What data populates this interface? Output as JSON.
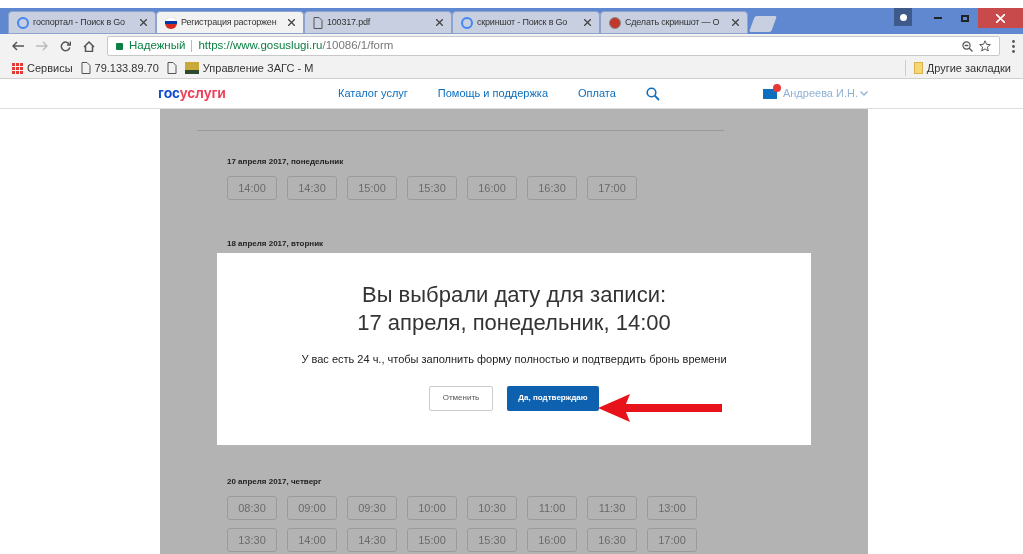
{
  "browser": {
    "tabs": [
      {
        "label": "госпортал - Поиск в Go",
        "kind": "google",
        "selected": false
      },
      {
        "label": "Регистрация расторжен",
        "kind": "flag",
        "selected": true
      },
      {
        "label": "100317.pdf",
        "kind": "page",
        "selected": false
      },
      {
        "label": "скриншот - Поиск в Go",
        "kind": "google",
        "selected": false
      },
      {
        "label": "Сделать скриншот — О",
        "kind": "app",
        "selected": false
      }
    ],
    "secure_label": "Надежный",
    "url_host": "https://www.gosuslugi.ru",
    "url_path": "/10086/1/form",
    "bookmarks": [
      {
        "label": "Сервисы",
        "kind": "apps"
      },
      {
        "label": "79.133.89.70",
        "kind": "page"
      },
      {
        "kind": "page"
      },
      {
        "label": "Управление ЗАГС - М",
        "kind": "image"
      }
    ],
    "other_bookmarks": "Другие закладки"
  },
  "site": {
    "logo_part1": "гос",
    "logo_part2": "услуги",
    "nav": [
      "Каталог услуг",
      "Помощь и поддержка",
      "Оплата"
    ],
    "user": "Андреева И.Н."
  },
  "days": [
    {
      "title": "17 апреля 2017, понедельник",
      "rows": [
        [
          "14:00",
          "14:30",
          "15:00",
          "15:30",
          "16:00",
          "16:30",
          "17:00"
        ]
      ]
    },
    {
      "title": "18 апреля 2017, вторник"
    },
    {
      "title": "20 апреля 2017, четверг",
      "rows": [
        [
          "08:30",
          "09:00",
          "09:30",
          "10:00",
          "10:30",
          "11:00",
          "11:30",
          "13:00"
        ],
        [
          "13:30",
          "14:00",
          "14:30",
          "15:00",
          "15:30",
          "16:00",
          "16:30",
          "17:00"
        ]
      ]
    }
  ],
  "modal": {
    "title_line1": "Вы выбрали дату для записи:",
    "title_line2": "17 апреля, понедельник, 14:00",
    "text": "У вас есть 24 ч., чтобы заполнить форму полностью и подтвердить бронь времени",
    "cancel": "Отменить",
    "confirm": "Да, подтверждаю"
  }
}
